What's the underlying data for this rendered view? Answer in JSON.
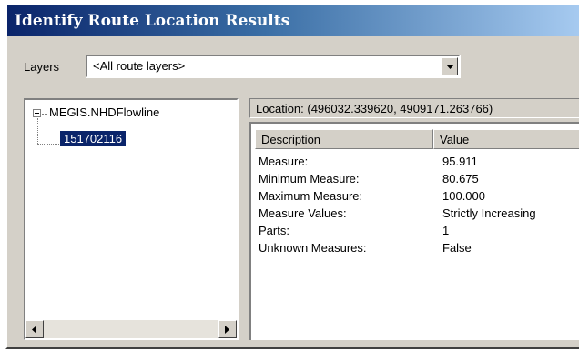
{
  "window": {
    "title": "Identify Route Location Results"
  },
  "layers": {
    "label": "Layers",
    "selected": "<All route layers>"
  },
  "tree": {
    "root": "MEGIS.NHDFlowline",
    "child": "151702116"
  },
  "location": {
    "text": "Location: (496032.339620, 4909171.263766)"
  },
  "table": {
    "headers": {
      "description": "Description",
      "value": "Value"
    },
    "rows": [
      {
        "key": "Measure:",
        "value": "95.911"
      },
      {
        "key": "Minimum Measure:",
        "value": "80.675"
      },
      {
        "key": "Maximum Measure:",
        "value": "100.000"
      },
      {
        "key": "Measure Values:",
        "value": "Strictly Increasing"
      },
      {
        "key": "Parts:",
        "value": "1"
      },
      {
        "key": "Unknown Measures:",
        "value": "False"
      }
    ]
  }
}
